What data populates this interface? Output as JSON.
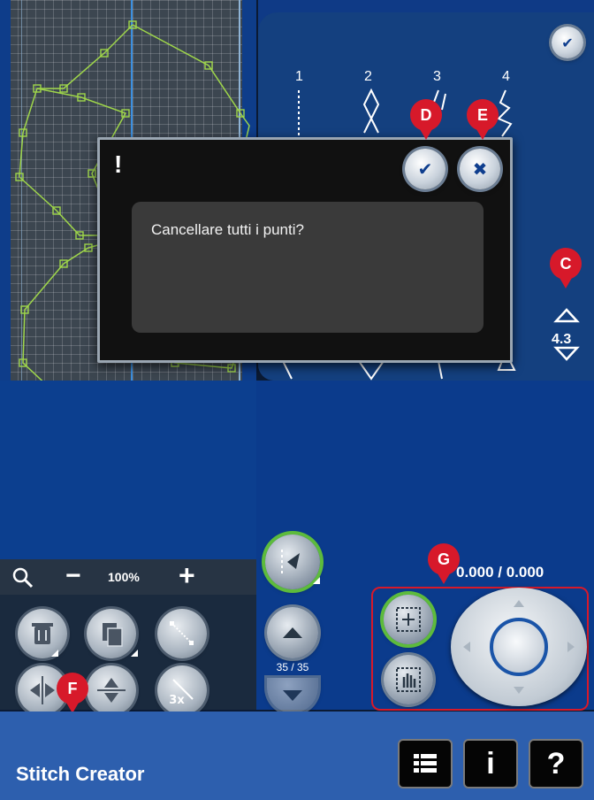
{
  "preview": {
    "stitch_numbers": [
      "1",
      "2",
      "3",
      "4"
    ],
    "density_value": "4.3"
  },
  "dialog": {
    "icon": "!",
    "message": "Cancellare tutti i punti?"
  },
  "callouts": {
    "d": "D",
    "e": "E",
    "c": "C",
    "f": "F",
    "g": "G"
  },
  "zoom": {
    "minus": "−",
    "value": "100%",
    "plus": "+"
  },
  "stitch_nav": {
    "counter": "35 / 35"
  },
  "position": {
    "coordinates": "0.000 / 0.000"
  },
  "edit_tools": {
    "multiply_label": "3x"
  },
  "status_bar": {
    "title": "Stitch Creator",
    "info_label": "i",
    "help_label": "?"
  },
  "icons": {
    "confirm": "checkmark-icon",
    "close": "close-icon",
    "delete": "trash-icon",
    "duplicate": "duplicate-icon",
    "insert": "insert-point-icon",
    "mirror_side": "mirror-side-to-side-icon",
    "mirror_end": "mirror-end-to-end-icon",
    "triple": "triple-stitch-icon",
    "select": "select-point-icon",
    "pan": "pan-icon",
    "menu": "menu-list-icon",
    "zoom": "magnifier-icon"
  },
  "colors": {
    "accent_red": "#d7192a",
    "stitch_green": "#9fd64a",
    "status_bar_blue": "#2d5fae"
  }
}
